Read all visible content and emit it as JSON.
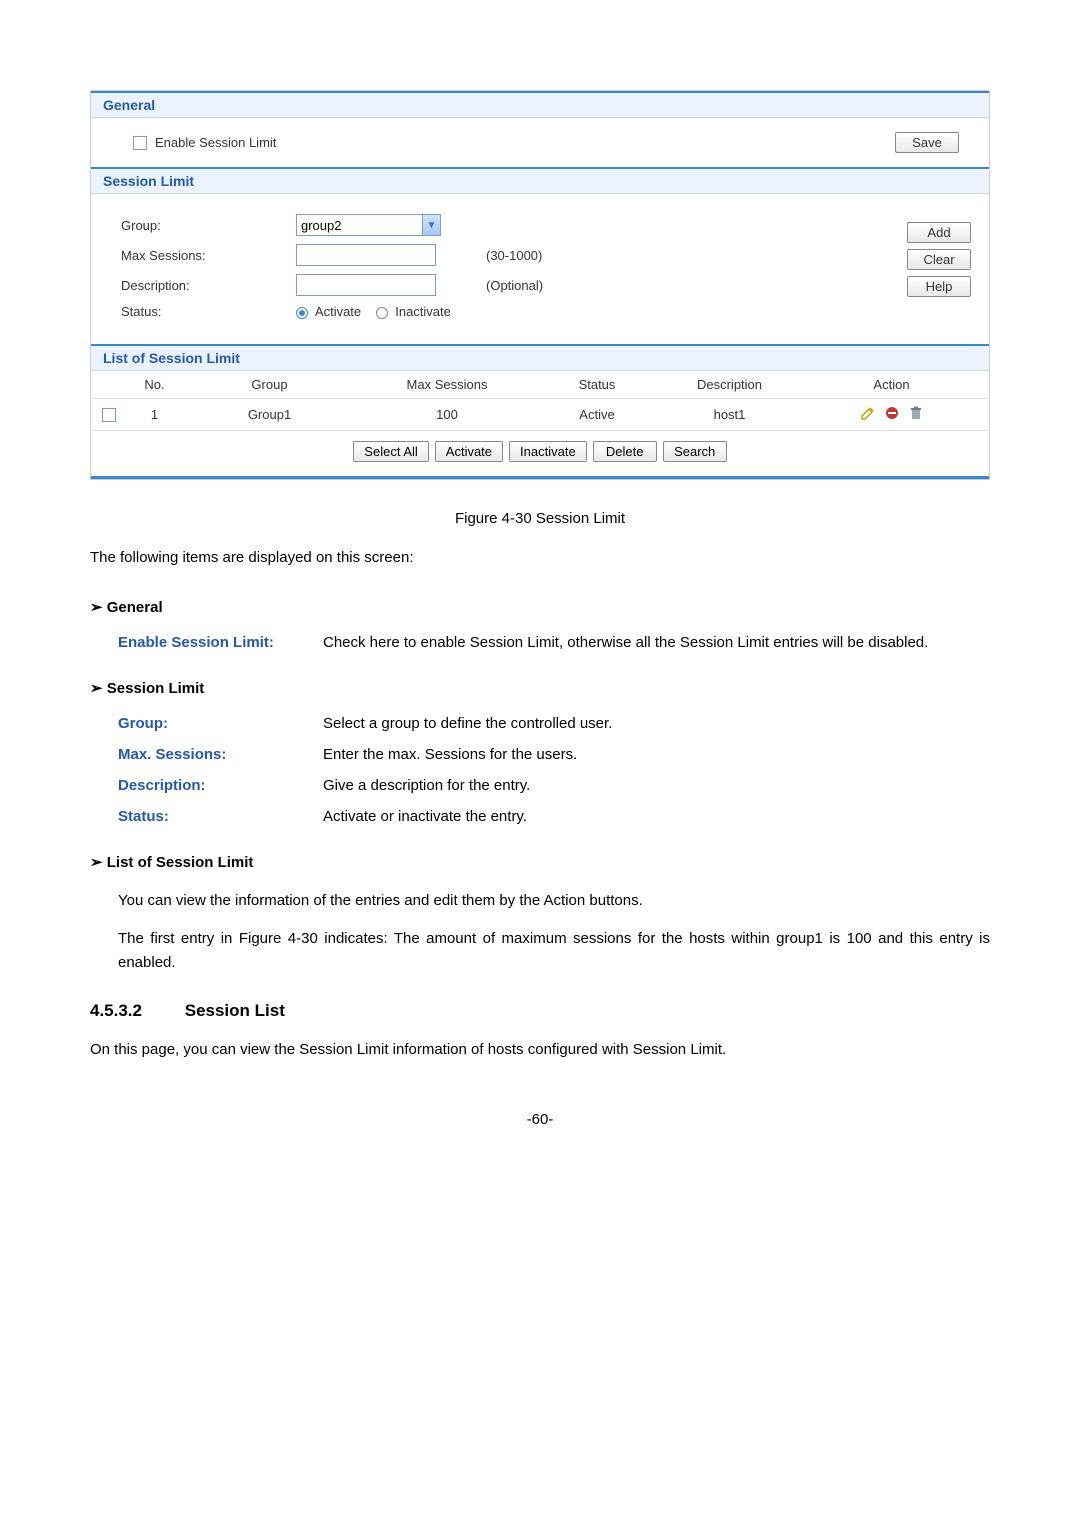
{
  "figure": {
    "general": {
      "title": "General",
      "enable_label": "Enable Session Limit",
      "save_btn": "Save"
    },
    "session_limit": {
      "title": "Session Limit",
      "group_label": "Group:",
      "group_value": "group2",
      "max_label": "Max Sessions:",
      "max_hint": "(30-1000)",
      "desc_label": "Description:",
      "desc_hint": "(Optional)",
      "status_label": "Status:",
      "status_activate": "Activate",
      "status_inactivate": "Inactivate",
      "add_btn": "Add",
      "clear_btn": "Clear",
      "help_btn": "Help"
    },
    "list": {
      "title": "List of Session Limit",
      "head": {
        "no": "No.",
        "group": "Group",
        "max": "Max Sessions",
        "status": "Status",
        "desc": "Description",
        "action": "Action"
      },
      "rows": [
        {
          "no": "1",
          "group": "Group1",
          "max": "100",
          "status": "Active",
          "desc": "host1"
        }
      ],
      "btns": {
        "select_all": "Select All",
        "activate": "Activate",
        "inactivate": "Inactivate",
        "delete": "Delete",
        "search": "Search"
      }
    }
  },
  "caption": "Figure 4-30 Session Limit",
  "intro": "The following items are displayed on this screen:",
  "sec_general": {
    "title": "General",
    "term": "Enable Session Limit:",
    "desc": "Check here to enable Session Limit, otherwise all the Session Limit entries will be disabled."
  },
  "sec_sl": {
    "title": "Session Limit",
    "items": [
      {
        "term": "Group:",
        "desc": "Select a group to define the controlled user."
      },
      {
        "term": "Max. Sessions:",
        "desc": "Enter the max. Sessions for the users."
      },
      {
        "term": "Description:",
        "desc": "Give a description for the entry."
      },
      {
        "term": "Status:",
        "desc": "Activate or inactivate the entry."
      }
    ]
  },
  "sec_list": {
    "title": "List of Session Limit",
    "p1": "You can view the information of the entries and edit them by the Action buttons.",
    "p2": "The first entry in Figure 4-30 indicates: The amount of maximum sessions for the hosts within group1 is 100 and this entry is enabled."
  },
  "subheading": {
    "num": "4.5.3.2",
    "title": "Session List"
  },
  "sub_p": "On this page, you can view the Session Limit information of hosts configured with Session Limit.",
  "page_number": "-60-"
}
